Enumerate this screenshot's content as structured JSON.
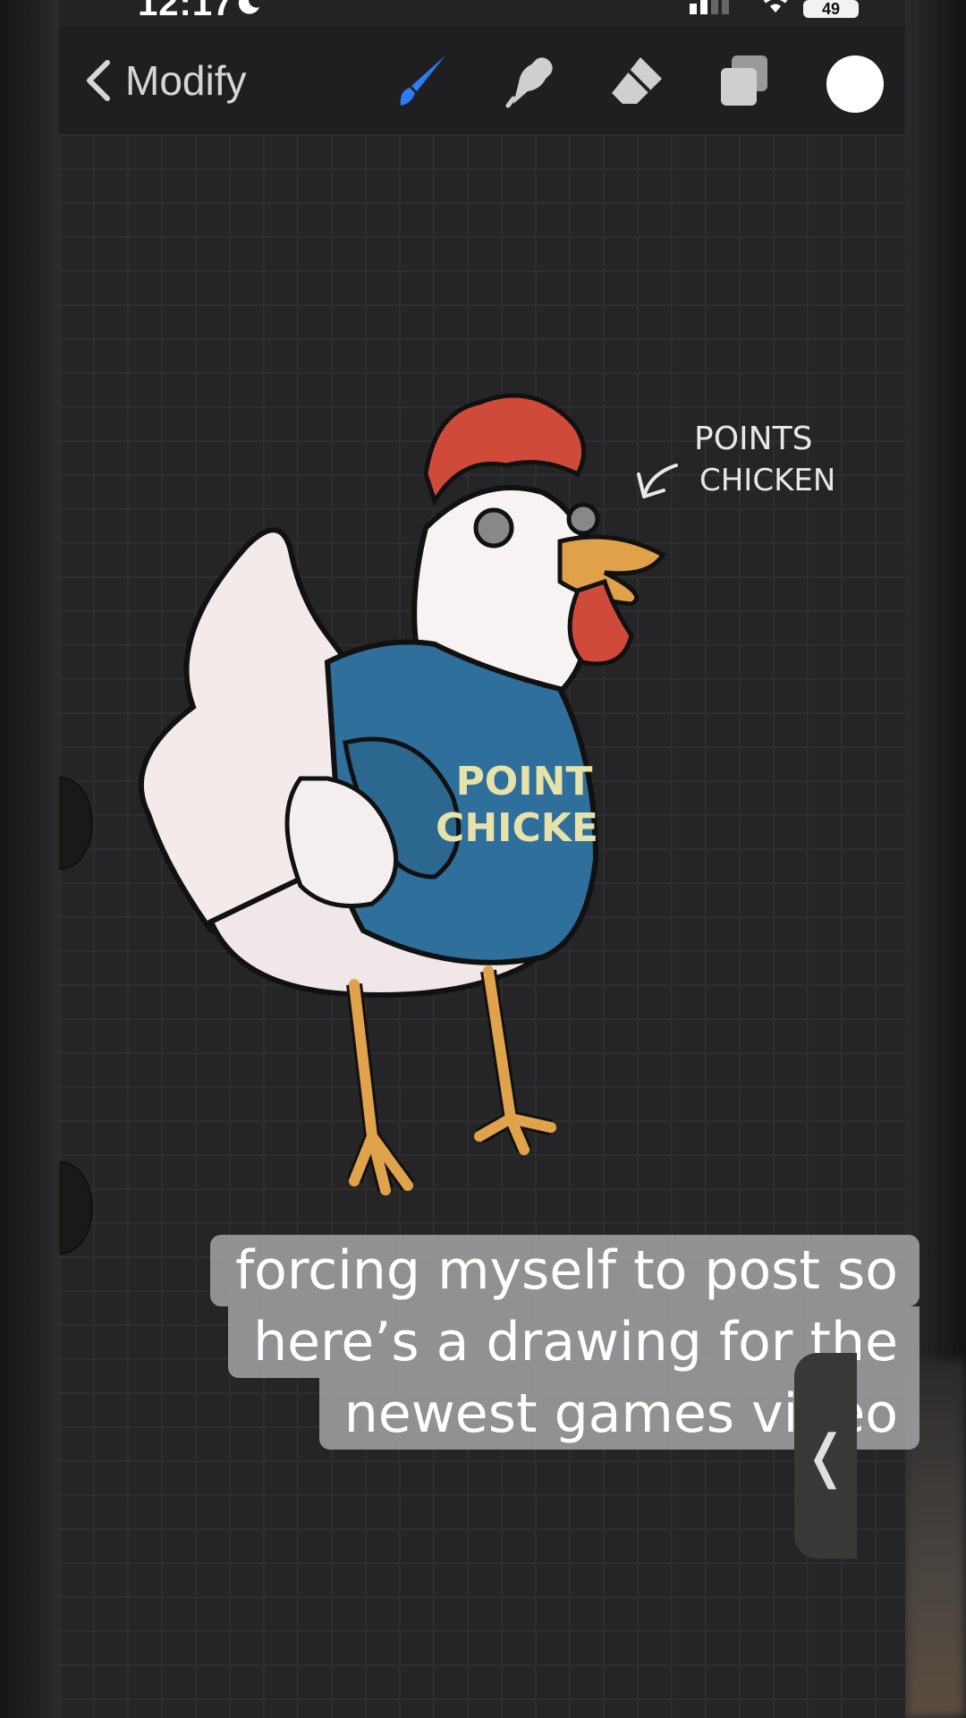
{
  "status_bar": {
    "time": "12:17",
    "battery": "49"
  },
  "toolbar": {
    "back_label": "Modify",
    "icons": {
      "back": "chevron-left-icon",
      "brush": "brush-icon",
      "smudge": "smudge-icon",
      "eraser": "eraser-icon",
      "layers": "layers-icon",
      "color": "color-swatch"
    },
    "active_tool_color": "#2f7bf5",
    "current_color": "#ffffff"
  },
  "canvas": {
    "annotation_line1": "POINTS",
    "annotation_line2": "CHICKEN",
    "shirt_line1": "POINT",
    "shirt_line2": "CHICKE"
  },
  "caption": {
    "line1": "forcing myself to post so",
    "line2": "here’s a drawing for the",
    "line3": "newest games video"
  },
  "collapse_glyph": "❬"
}
